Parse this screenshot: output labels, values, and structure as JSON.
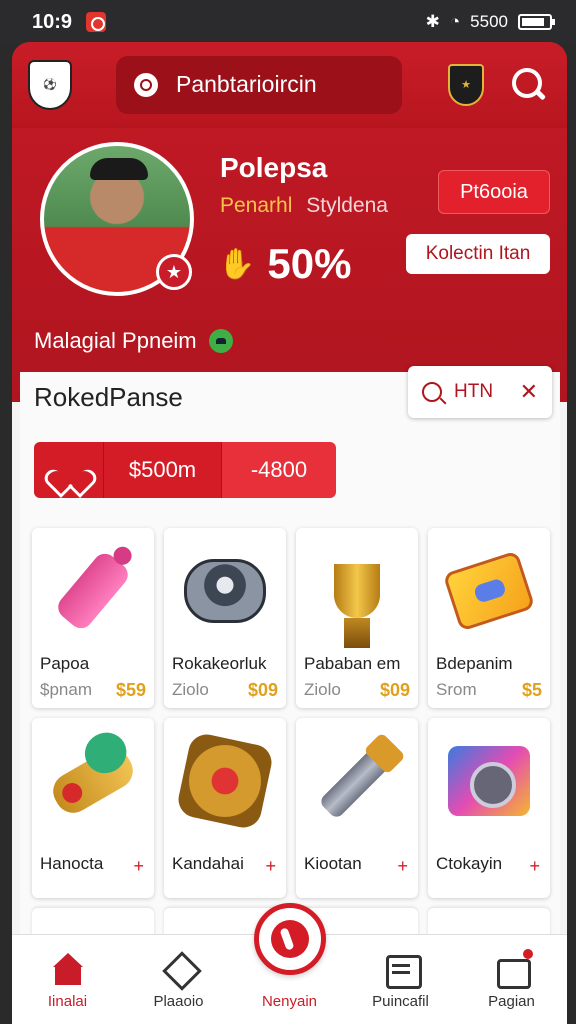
{
  "status": {
    "time": "10:9",
    "right_text": "5500"
  },
  "header": {
    "club_logo": "club-crest",
    "search_placeholder": "Panbtarioircin",
    "badge": "club-shield",
    "search_icon": "search-icon"
  },
  "profile": {
    "name": "Polepsa",
    "sub_primary": "Penarhl",
    "sub_secondary": "Styldena",
    "percent": "50%",
    "action_primary": "Pt6ooia",
    "action_secondary": "Kolectin Itan",
    "collection_title": "Malagial Ppneim"
  },
  "panel": {
    "title": "RokedPanse",
    "filter_text": "HTN",
    "price": "$500m",
    "delta": "-4800"
  },
  "items": [
    {
      "name": "Papoa",
      "meta": "$pnam",
      "cost": "$59",
      "art": "bottle"
    },
    {
      "name": "Rokakeorluk",
      "meta": "Ziolo",
      "cost": "$09",
      "art": "gadget"
    },
    {
      "name": "Pababan em",
      "meta": "Ziolo",
      "cost": "$09",
      "art": "trophy"
    },
    {
      "name": "Bdepanim",
      "meta": "Srom",
      "cost": "$5",
      "art": "box"
    },
    {
      "name": "Hanocta",
      "tag": "+",
      "art": "scroll"
    },
    {
      "name": "Kandahai",
      "tag": "+",
      "art": "shield"
    },
    {
      "name": "Kiootan",
      "tag": "+",
      "art": "tool"
    },
    {
      "name": "Ctokayin",
      "tag": "+",
      "art": "machine"
    }
  ],
  "nav": {
    "home": "Iinalai",
    "diamond": "Plaaoio",
    "center": "Nenyain",
    "list": "Puincafil",
    "edit": "Pagian"
  },
  "colors": {
    "brand": "#c81d28",
    "accent_gold": "#e0a11c"
  }
}
